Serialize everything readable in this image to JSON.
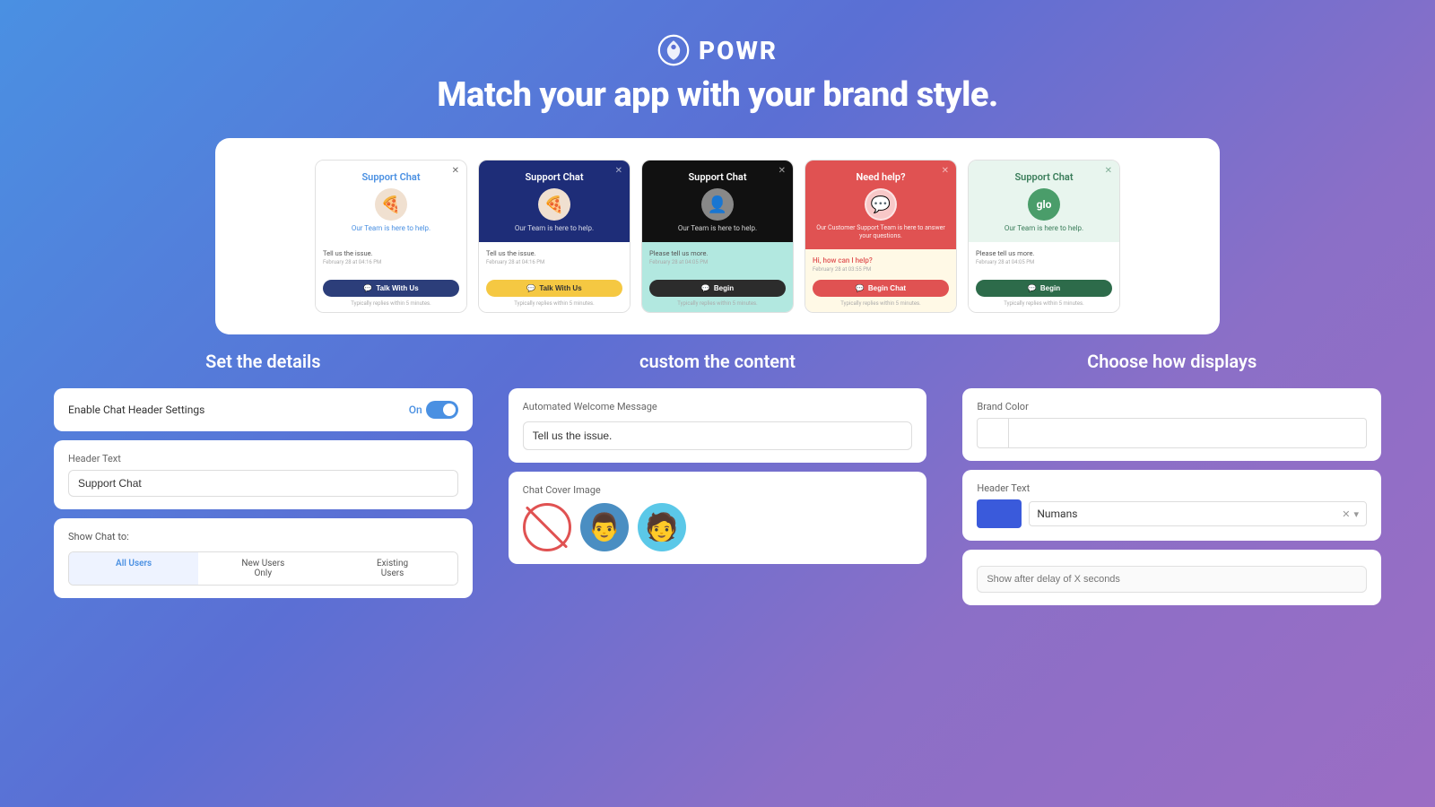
{
  "header": {
    "logo_text": "POWR",
    "tagline": "Match your app with your brand style."
  },
  "preview_cards": [
    {
      "id": "card1",
      "title": "Support Chat",
      "subtitle": "Our Team is here to help.",
      "message": "Tell us the issue.",
      "date": "February 28 at 04:16 PM",
      "btn_label": "Talk With Us",
      "footer": "Typically replies within 5 minutes.",
      "avatar_emoji": "🍕",
      "theme": "light"
    },
    {
      "id": "card2",
      "title": "Support Chat",
      "subtitle": "Our Team is here to help.",
      "message": "Tell us the issue.",
      "date": "February 28 at 04:16 PM",
      "btn_label": "Talk With Us",
      "footer": "Typically replies within 5 minutes.",
      "avatar_emoji": "🍕",
      "theme": "dark-blue"
    },
    {
      "id": "card3",
      "title": "Support Chat",
      "subtitle": "Our Team is here to help.",
      "message": "Please tell us more.",
      "date": "February 28 at 04:05 PM",
      "btn_label": "Begin",
      "footer": "Typically replies within 5 minutes.",
      "avatar_emoji": "👤",
      "theme": "dark-teal"
    },
    {
      "id": "card4",
      "title": "Need help?",
      "subtitle": "Our Customer Support Team is here to answer your questions.",
      "message": "Hi, how can I help?",
      "date": "February 28 at 03:55 PM",
      "btn_label": "Begin Chat",
      "footer": "Typically replies within 5 minutes.",
      "avatar_emoji": "💬",
      "theme": "red"
    },
    {
      "id": "card5",
      "title": "Support Chat",
      "subtitle": "Our Team is here to help.",
      "message": "Please tell us more.",
      "date": "February 28 at 04:05 PM",
      "btn_label": "Begin",
      "footer": "Typically replies within 5 minutes.",
      "avatar_emoji": "🟢",
      "theme": "mint"
    }
  ],
  "sections": {
    "left": {
      "title": "Set the details",
      "enable_chat_label": "Enable Chat Header Settings",
      "toggle_state": "On",
      "header_text_label": "Header Text",
      "header_text_value": "Support Chat",
      "show_chat_label": "Show Chat to:",
      "radio_options": [
        "All Users",
        "New Users Only",
        "Existing Users"
      ],
      "radio_active": "All Users"
    },
    "middle": {
      "title": "custom the content",
      "welcome_message_label": "Automated Welcome Message",
      "welcome_message_value": "Tell us the issue.",
      "cover_image_label": "Chat Cover Image"
    },
    "right": {
      "title": "Choose how displays",
      "brand_color_label": "Brand Color",
      "brand_color_value": "",
      "header_text_label": "Header Text",
      "header_text_value": "Numans",
      "delay_placeholder": "Show after delay of X seconds"
    }
  }
}
